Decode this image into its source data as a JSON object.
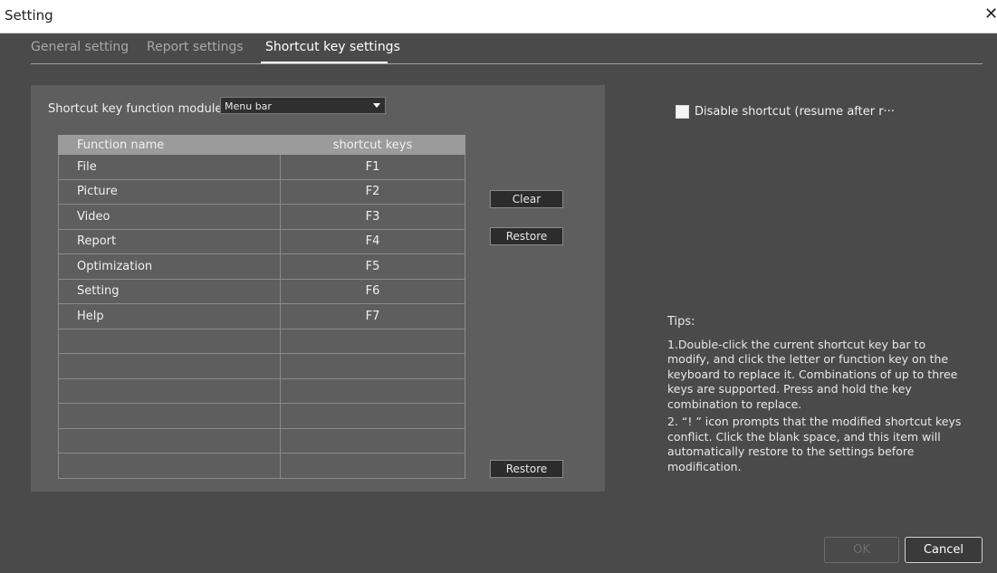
{
  "window": {
    "title": "Setting",
    "close_glyph": "✕"
  },
  "tabs": [
    {
      "label": "General setting",
      "active": false
    },
    {
      "label": "Report settings",
      "active": false
    },
    {
      "label": "Shortcut key settings",
      "active": true
    }
  ],
  "module": {
    "label": "Shortcut key function module：",
    "selected": "Menu bar"
  },
  "table": {
    "columns": [
      "Function name",
      "shortcut keys"
    ],
    "rows": [
      {
        "name": "File",
        "key": "F1"
      },
      {
        "name": "Picture",
        "key": "F2"
      },
      {
        "name": "Video",
        "key": "F3"
      },
      {
        "name": "Report",
        "key": "F4"
      },
      {
        "name": "Optimization",
        "key": "F5"
      },
      {
        "name": "Setting",
        "key": "F6"
      },
      {
        "name": "Help",
        "key": "F7"
      },
      {
        "name": "",
        "key": ""
      },
      {
        "name": "",
        "key": ""
      },
      {
        "name": "",
        "key": ""
      },
      {
        "name": "",
        "key": ""
      },
      {
        "name": "",
        "key": ""
      },
      {
        "name": "",
        "key": ""
      }
    ]
  },
  "buttons": {
    "clear": "Clear",
    "restore_top": "Restore",
    "restore_bottom": "Restore",
    "ok": "OK",
    "cancel": "Cancel"
  },
  "disable_shortcut": {
    "label": "Disable shortcut (resume after r···",
    "checked": false
  },
  "tips": {
    "title": "Tips:",
    "items": [
      "1.Double-click the current shortcut key bar to modify, and click the letter or function key on the keyboard to replace it. Combinations of up to three keys are supported. Press and hold the key combination to replace.",
      "2. “! ” icon prompts that the modified shortcut keys conflict. Click the blank space, and this item will automatically restore to the settings before modification."
    ]
  },
  "colors": {
    "background": "#4a4a4a",
    "panel": "#5e5e5e",
    "header": "#9b9b9b",
    "titlebar": "#ffffff"
  }
}
